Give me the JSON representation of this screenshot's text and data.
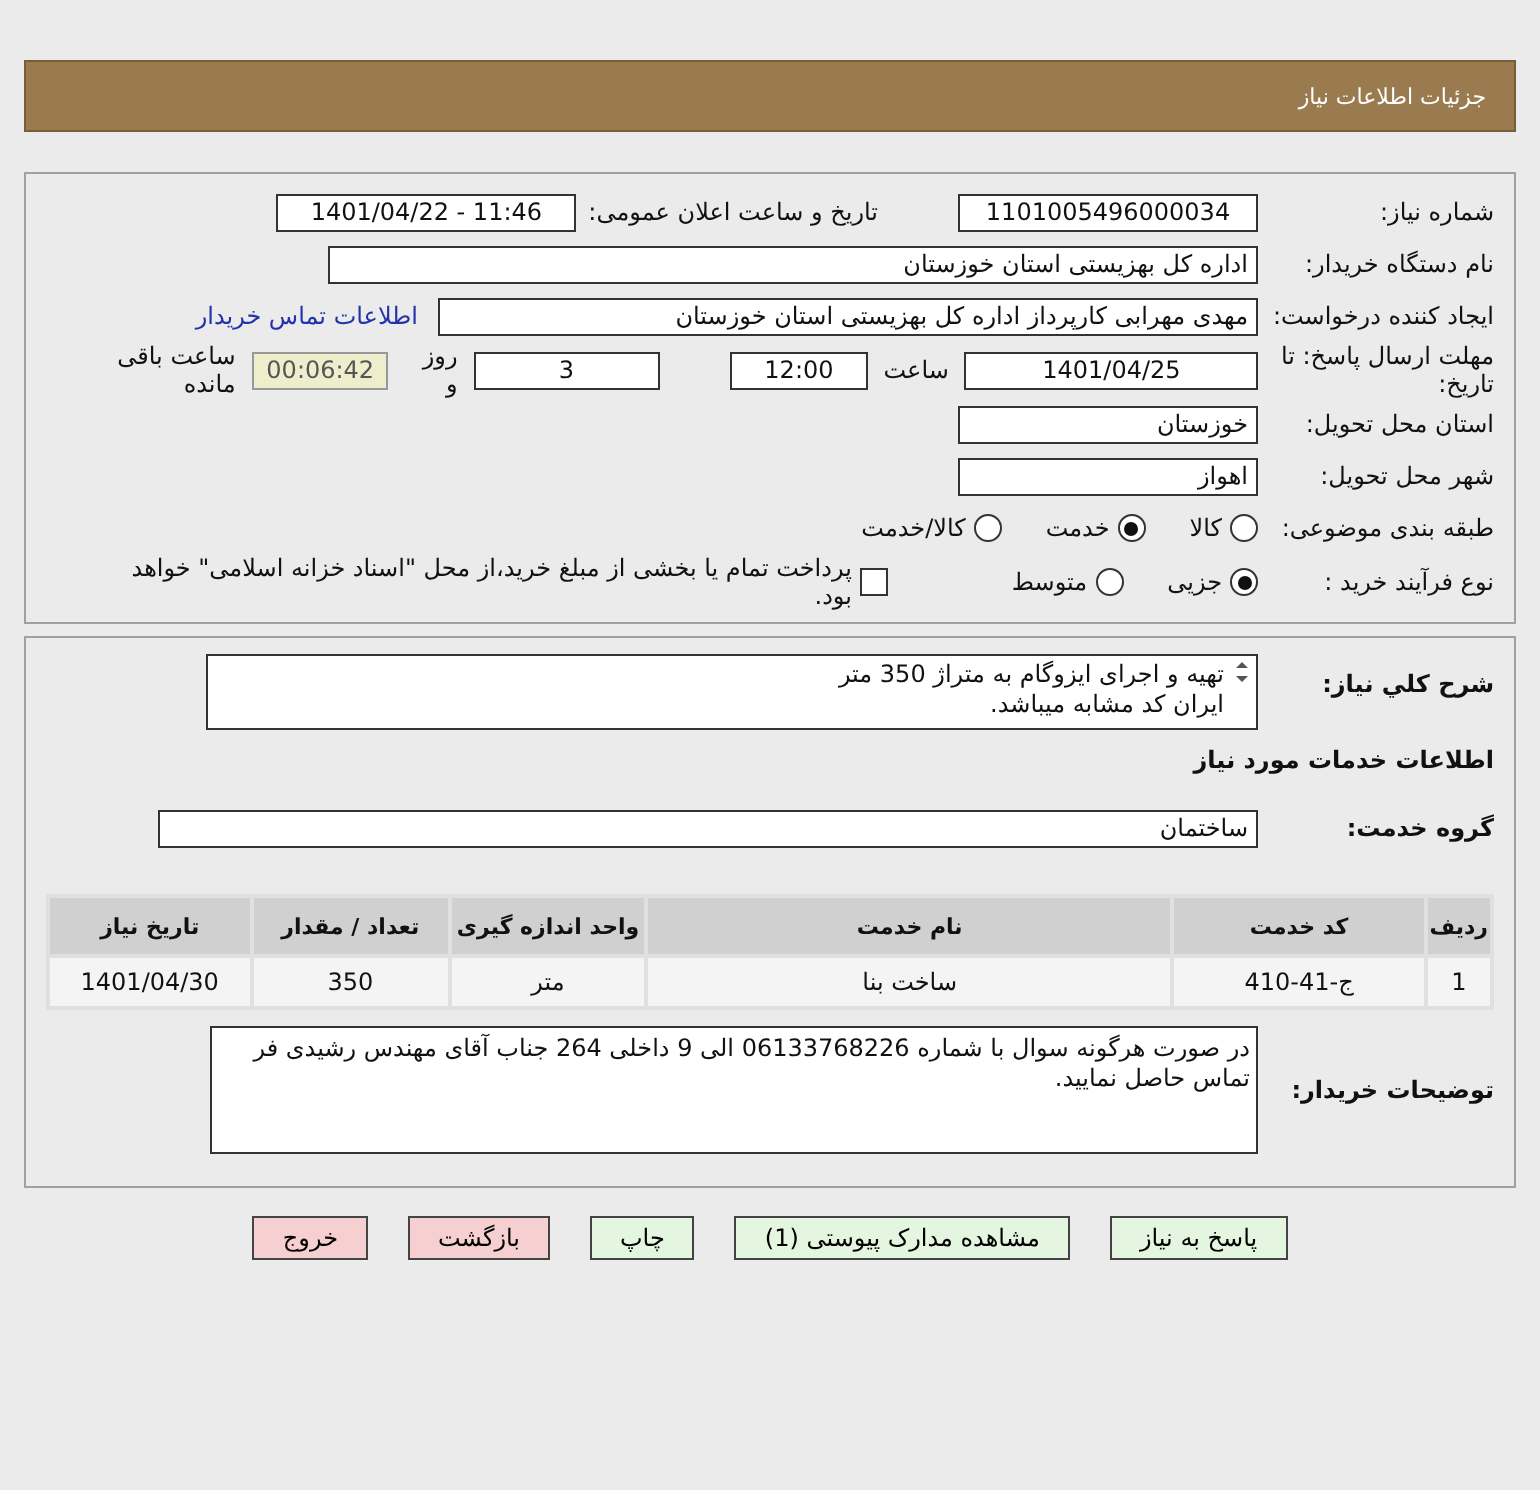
{
  "header": {
    "title": "جزئیات اطلاعات نیاز"
  },
  "details": {
    "need_number": {
      "label": "شماره نیاز:",
      "value": "1101005496000034"
    },
    "announce": {
      "label": "تاریخ و ساعت اعلان عمومی:",
      "value": "1401/04/22 - 11:46"
    },
    "buyer_org": {
      "label": "نام دستگاه خریدار:",
      "value": "اداره کل بهزیستی استان خوزستان"
    },
    "requester": {
      "label": "ایجاد کننده درخواست:",
      "value": "مهدی مهرابی کارپرداز اداره کل بهزیستی استان خوزستان",
      "link": "اطلاعات تماس خریدار"
    },
    "deadline": {
      "label": "مهلت ارسال پاسخ: تا تاریخ:",
      "date": "1401/04/25",
      "time_label": "ساعت",
      "time": "12:00",
      "days": "3",
      "days_label": "روز و",
      "remaining": "00:06:42",
      "remaining_label": "ساعت باقی مانده"
    },
    "province": {
      "label": "استان محل تحویل:",
      "value": "خوزستان"
    },
    "city": {
      "label": "شهر محل تحویل:",
      "value": "اهواز"
    },
    "category": {
      "label": "طبقه بندی موضوعی:",
      "options": [
        {
          "label": "کالا",
          "selected": false
        },
        {
          "label": "خدمت",
          "selected": true
        },
        {
          "label": "کالا/خدمت",
          "selected": false
        }
      ]
    },
    "process": {
      "label": "نوع فرآیند خرید :",
      "options": [
        {
          "label": "جزیی",
          "selected": true
        },
        {
          "label": "متوسط",
          "selected": false
        }
      ],
      "payment": {
        "label": "پرداخت تمام یا بخشی از مبلغ خرید،از محل \"اسناد خزانه اسلامی\" خواهد بود.",
        "checked": false
      }
    }
  },
  "needs": {
    "description": {
      "label": "شرح کلي نياز:",
      "lines": [
        "تهیه و اجرای ایزوگام به متراژ 350 متر",
        "ایران کد مشابه میباشد."
      ]
    },
    "services_title": "اطلاعات خدمات مورد نیاز",
    "group": {
      "label": "گروه خدمت:",
      "value": "ساختمان"
    },
    "table": {
      "columns": [
        "ردیف",
        "کد خدمت",
        "نام خدمت",
        "واحد اندازه گیری",
        "تعداد / مقدار",
        "تاریخ نیاز"
      ],
      "rows": [
        [
          "1",
          "ج-41-410",
          "ساخت بنا",
          "متر",
          "350",
          "1401/04/30"
        ]
      ]
    },
    "notes": {
      "label": "توضیحات خریدار:",
      "value": "در صورت هرگونه سوال با شماره 06133768226 الی 9 داخلی 264 جناب آقای مهندس رشیدی فر تماس حاصل نمایید."
    }
  },
  "buttons": [
    {
      "label": "پاسخ به نیاز",
      "kind": "action"
    },
    {
      "label": "مشاهده مدارک پیوستی (1)",
      "kind": "action"
    },
    {
      "label": "چاپ",
      "kind": "action"
    },
    {
      "label": "بازگشت",
      "kind": "cancel"
    },
    {
      "label": "خروج",
      "kind": "cancel"
    }
  ]
}
